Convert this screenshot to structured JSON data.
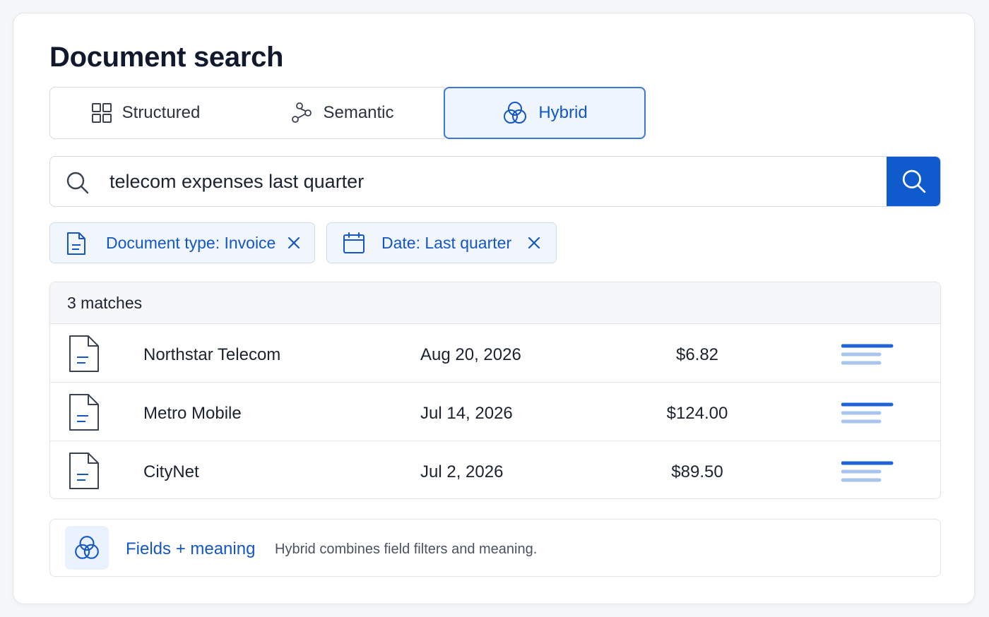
{
  "title": "Document search",
  "tabs": [
    {
      "label": "Structured",
      "icon": "grid-icon"
    },
    {
      "label": "Semantic",
      "icon": "nodes-icon"
    },
    {
      "label": "Hybrid",
      "icon": "venn-icon",
      "selected": true
    }
  ],
  "search": {
    "value": "telecom expenses last quarter"
  },
  "filters": [
    {
      "label": "Document type: Invoice",
      "icon": "document-icon"
    },
    {
      "label": "Date: Last quarter",
      "icon": "calendar-icon"
    }
  ],
  "results": {
    "count_label": "3 matches",
    "rows": [
      {
        "name": "Northstar Telecom",
        "date": "Aug 20, 2026",
        "amount": "$6.82"
      },
      {
        "name": "Metro Mobile",
        "date": "Jul 14, 2026",
        "amount": "$124.00"
      },
      {
        "name": "CityNet",
        "date": "Jul 2, 2026",
        "amount": "$89.50"
      }
    ]
  },
  "hint": {
    "label": "Fields + meaning",
    "text": "Hybrid combines field filters and meaning."
  },
  "colors": {
    "accent": "#0f5acd",
    "accent_light": "#eef5fe",
    "text": "#1b2230",
    "border": "#d5d9df"
  }
}
